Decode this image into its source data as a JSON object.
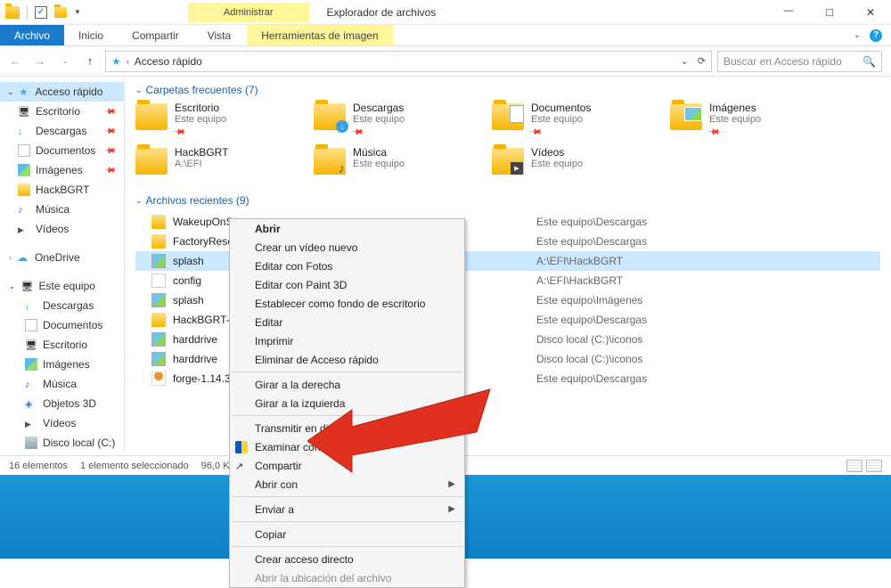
{
  "window": {
    "title": "Explorador de archivos",
    "manage_tab": "Administrar"
  },
  "ribbon": {
    "file": "Archivo",
    "home": "Inicio",
    "share": "Compartir",
    "view": "Vista",
    "image_tools": "Herramientas de imagen"
  },
  "address": {
    "path": "Acceso rápido",
    "search_placeholder": "Buscar en Acceso rápido"
  },
  "sidebar": {
    "quick_access": "Acceso rápido",
    "items": [
      {
        "label": "Escritorio",
        "pinned": true,
        "icon": "ico-monitor"
      },
      {
        "label": "Descargas",
        "pinned": true,
        "icon": "ico-down"
      },
      {
        "label": "Documentos",
        "pinned": true,
        "icon": "ico-doc"
      },
      {
        "label": "Imágenes",
        "pinned": true,
        "icon": "ico-img"
      },
      {
        "label": "HackBGRT",
        "pinned": false,
        "icon": "ico-folder"
      },
      {
        "label": "Música",
        "pinned": false,
        "icon": "ico-music"
      },
      {
        "label": "Vídeos",
        "pinned": false,
        "icon": "ico-video"
      }
    ],
    "onedrive": "OneDrive",
    "this_pc": "Este equipo",
    "pc_items": [
      {
        "label": "Descargas",
        "icon": "ico-down"
      },
      {
        "label": "Documentos",
        "icon": "ico-doc"
      },
      {
        "label": "Escritorio",
        "icon": "ico-monitor"
      },
      {
        "label": "Imágenes",
        "icon": "ico-img"
      },
      {
        "label": "Música",
        "icon": "ico-music"
      },
      {
        "label": "Objetos 3D",
        "icon": "ico-3d"
      },
      {
        "label": "Vídeos",
        "icon": "ico-video"
      },
      {
        "label": "Disco local (C:)",
        "icon": "ico-hdd"
      }
    ]
  },
  "sections": {
    "frequent": "Carpetas frecuentes (7)",
    "recent": "Archivos recientes (9)"
  },
  "frequent": [
    {
      "name": "Escritorio",
      "sub": "Este equipo",
      "pinned": true,
      "cls": ""
    },
    {
      "name": "Descargas",
      "sub": "Este equipo",
      "pinned": true,
      "cls": "dl"
    },
    {
      "name": "Documentos",
      "sub": "Este equipo",
      "pinned": true,
      "cls": "docs"
    },
    {
      "name": "Imágenes",
      "sub": "Este equipo",
      "pinned": true,
      "cls": "img"
    },
    {
      "name": "HackBGRT",
      "sub": "A:\\EFI",
      "pinned": false,
      "cls": ""
    },
    {
      "name": "Música",
      "sub": "Este equipo",
      "pinned": false,
      "cls": "music"
    },
    {
      "name": "Vídeos",
      "sub": "Este equipo",
      "pinned": false,
      "cls": "video"
    }
  ],
  "recent": [
    {
      "name": "WakeupOnS",
      "path": "Este equipo\\Descargas",
      "icon": "rico-folder",
      "selected": false
    },
    {
      "name": "FactoryRese",
      "path": "Este equipo\\Descargas",
      "icon": "rico-folder",
      "selected": false
    },
    {
      "name": "splash",
      "path": "A:\\EFI\\HackBGRT",
      "icon": "rico-bmp",
      "selected": true
    },
    {
      "name": "config",
      "path": "A:\\EFI\\HackBGRT",
      "icon": "rico-file",
      "selected": false
    },
    {
      "name": "splash",
      "path": "Este equipo\\Imágenes",
      "icon": "rico-bmp",
      "selected": false
    },
    {
      "name": "HackBGRT-1",
      "path": "Este equipo\\Descargas",
      "icon": "rico-folder",
      "selected": false
    },
    {
      "name": "harddrive",
      "path": "Disco local (C:)\\iconos",
      "icon": "rico-bmp",
      "selected": false
    },
    {
      "name": "harddrive",
      "path": "Disco local (C:)\\iconos",
      "icon": "rico-bmp",
      "selected": false
    },
    {
      "name": "forge-1.14.3",
      "path": "Este equipo\\Descargas",
      "icon": "rico-jar",
      "selected": false
    }
  ],
  "status": {
    "count": "16 elementos",
    "selection": "1 elemento seleccionado",
    "size": "96,0 KB"
  },
  "context_menu": [
    {
      "label": "Abrir",
      "bold": true
    },
    {
      "label": "Crear un vídeo nuevo"
    },
    {
      "label": "Editar con Fotos"
    },
    {
      "label": "Editar con Paint 3D"
    },
    {
      "label": "Establecer como fondo de escritorio"
    },
    {
      "label": "Editar"
    },
    {
      "label": "Imprimir"
    },
    {
      "label": "Eliminar de Acceso rápido"
    },
    {
      "sep": true
    },
    {
      "label": "Girar a la derecha"
    },
    {
      "label": "Girar a la izquierda"
    },
    {
      "sep": true
    },
    {
      "label": "Transmitir en disposi",
      "arrow": true
    },
    {
      "label": "Examinar con Wi                    nder...",
      "icon": "micon-shield"
    },
    {
      "label": "Compartir",
      "icon": "micon-share"
    },
    {
      "label": "Abrir con",
      "arrow": true
    },
    {
      "sep": true
    },
    {
      "label": "Enviar a",
      "arrow": true
    },
    {
      "sep": true
    },
    {
      "label": "Copiar"
    },
    {
      "sep": true
    },
    {
      "label": "Crear acceso directo"
    },
    {
      "label": "Abrir la ubicación del archivo",
      "cut": true
    }
  ]
}
